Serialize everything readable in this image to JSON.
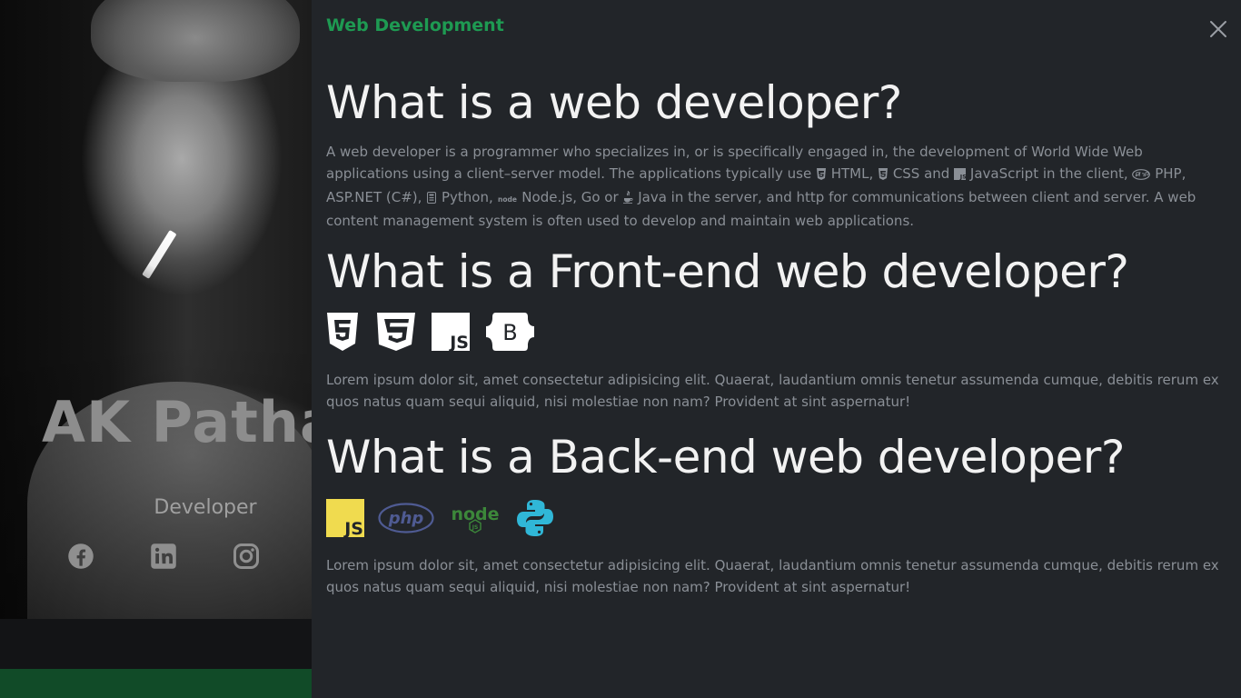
{
  "profile": {
    "name": "AK Pathan",
    "role": "Developer",
    "social": [
      "facebook-icon",
      "linkedin-icon",
      "instagram-icon"
    ]
  },
  "modal": {
    "title": "Web Development",
    "close_icon": "close-icon",
    "sections": [
      {
        "heading": "What is a web developer?",
        "paragraph": {
          "p1": "A web developer is a programmer who specializes in, or is specifically engaged in, the development of World Wide Web applications using a client–server model. The applications typically use ",
          "html": "HTML,",
          "css": "CSS and",
          "js": "JavaScript in the client,",
          "php": "PHP, ASP.NET (C#),",
          "python": "Python,",
          "node": "Node.js, Go or",
          "java": "Java in the server, and http for communications between client and server. A web content management system is often used to develop and maintain web applications."
        }
      },
      {
        "heading": "What is a Front-end web developer?",
        "icons": [
          "html5-icon",
          "css3-icon",
          "javascript-icon",
          "bootstrap-icon"
        ],
        "paragraph": "Lorem ipsum dolor sit, amet consectetur adipisicing elit. Quaerat, laudantium omnis tenetur assumenda cumque, debitis rerum ex quos natus quam sequi aliquid, nisi molestiae non nam? Provident at sint aspernatur!"
      },
      {
        "heading": "What is a Back-end web developer?",
        "icons": [
          "javascript-icon",
          "php-icon",
          "nodejs-icon",
          "python-icon"
        ],
        "paragraph": "Lorem ipsum dolor sit, amet consectetur adipisicing elit. Quaerat, laudantium omnis tenetur assumenda cumque, debitis rerum ex quos natus quam sequi aliquid, nisi molestiae non nam? Provident at sint aspernatur!"
      }
    ],
    "logo_text": {
      "js": "JS",
      "b": "B",
      "php": "php",
      "node": "node",
      "node_badge": "JS"
    }
  },
  "colors": {
    "accent_green": "#1e9a52",
    "background": "#222529",
    "heading": "#f2f2f2",
    "body_text": "#8a8f96",
    "js_yellow": "#f0db4f",
    "php_blue": "#4f5b93",
    "node_green": "#3c873a",
    "python_blue": "#30b7d7"
  }
}
